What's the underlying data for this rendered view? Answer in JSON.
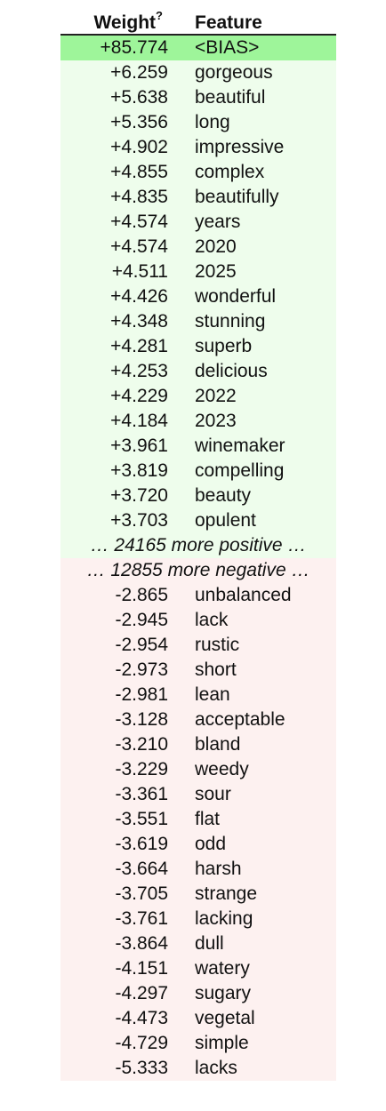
{
  "header": {
    "weight_label": "Weight",
    "weight_sup": "?",
    "feature_label": "Feature"
  },
  "bias": {
    "weight": "+85.774",
    "feature": "<BIAS>",
    "color": "#9ef59a"
  },
  "positive": [
    {
      "weight": "+6.259",
      "feature": "gorgeous"
    },
    {
      "weight": "+5.638",
      "feature": "beautiful"
    },
    {
      "weight": "+5.356",
      "feature": "long"
    },
    {
      "weight": "+4.902",
      "feature": "impressive"
    },
    {
      "weight": "+4.855",
      "feature": "complex"
    },
    {
      "weight": "+4.835",
      "feature": "beautifully"
    },
    {
      "weight": "+4.574",
      "feature": "years"
    },
    {
      "weight": "+4.574",
      "feature": "2020"
    },
    {
      "weight": "+4.511",
      "feature": "2025"
    },
    {
      "weight": "+4.426",
      "feature": "wonderful"
    },
    {
      "weight": "+4.348",
      "feature": "stunning"
    },
    {
      "weight": "+4.281",
      "feature": "superb"
    },
    {
      "weight": "+4.253",
      "feature": "delicious"
    },
    {
      "weight": "+4.229",
      "feature": "2022"
    },
    {
      "weight": "+4.184",
      "feature": "2023"
    },
    {
      "weight": "+3.961",
      "feature": "winemaker"
    },
    {
      "weight": "+3.819",
      "feature": "compelling"
    },
    {
      "weight": "+3.720",
      "feature": "beauty"
    },
    {
      "weight": "+3.703",
      "feature": "opulent"
    }
  ],
  "more_positive": "… 24165 more positive …",
  "more_negative": "… 12855 more negative …",
  "negative": [
    {
      "weight": "-2.865",
      "feature": "unbalanced"
    },
    {
      "weight": "-2.945",
      "feature": "lack"
    },
    {
      "weight": "-2.954",
      "feature": "rustic"
    },
    {
      "weight": "-2.973",
      "feature": "short"
    },
    {
      "weight": "-2.981",
      "feature": "lean"
    },
    {
      "weight": "-3.128",
      "feature": "acceptable"
    },
    {
      "weight": "-3.210",
      "feature": "bland"
    },
    {
      "weight": "-3.229",
      "feature": "weedy"
    },
    {
      "weight": "-3.361",
      "feature": "sour"
    },
    {
      "weight": "-3.551",
      "feature": "flat"
    },
    {
      "weight": "-3.619",
      "feature": "odd"
    },
    {
      "weight": "-3.664",
      "feature": "harsh"
    },
    {
      "weight": "-3.705",
      "feature": "strange"
    },
    {
      "weight": "-3.761",
      "feature": "lacking"
    },
    {
      "weight": "-3.864",
      "feature": "dull"
    },
    {
      "weight": "-4.151",
      "feature": "watery"
    },
    {
      "weight": "-4.297",
      "feature": "sugary"
    },
    {
      "weight": "-4.473",
      "feature": "vegetal"
    },
    {
      "weight": "-4.729",
      "feature": "simple"
    },
    {
      "weight": "-5.333",
      "feature": "lacks"
    }
  ],
  "colors": {
    "positive_bg": "#eefdec",
    "negative_bg": "#fdf1f0",
    "header_rule": "#222222"
  }
}
